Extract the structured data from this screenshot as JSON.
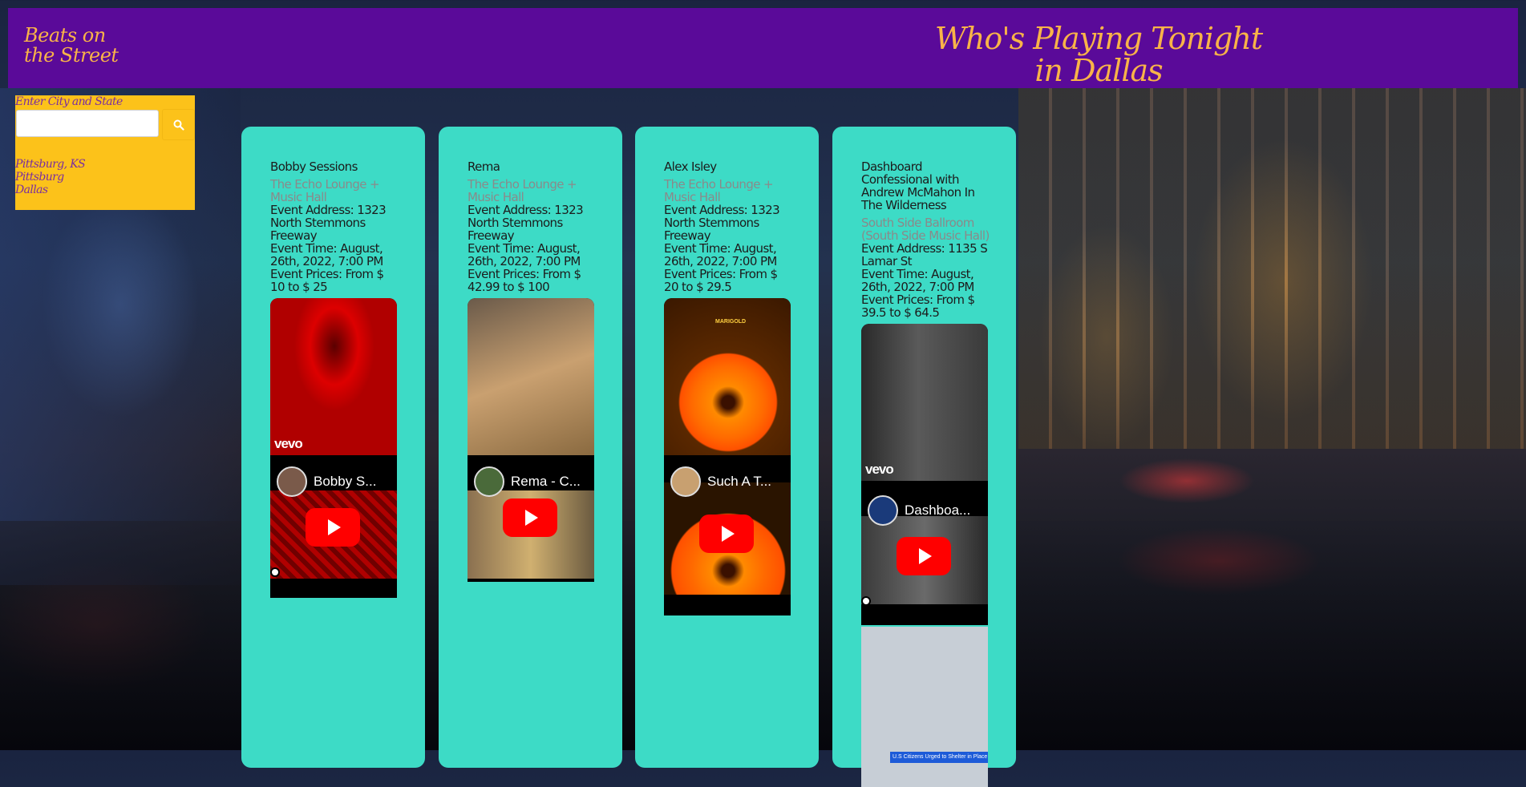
{
  "header": {
    "logo": "Beats on the Street",
    "headline": "Who's Playing Tonight in Dallas"
  },
  "search": {
    "label": "Enter City and State",
    "value": "",
    "history": [
      "Pittsburg, KS",
      "Pittsburg",
      "Dallas"
    ]
  },
  "events": [
    {
      "artist": "Bobby Sessions",
      "venue": "The Echo Lounge + Music Hall",
      "address": "Event Address: 1323 North Stemmons Freeway",
      "time": "Event Time: August, 26th, 2022, 7:00 PM",
      "prices": "Event Prices: From $ 10 to $ 25",
      "video_title": "Bobby S...",
      "video_badge": "vevo"
    },
    {
      "artist": "Rema",
      "venue": "The Echo Lounge + Music Hall",
      "address": "Event Address: 1323 North Stemmons Freeway",
      "time": "Event Time: August, 26th, 2022, 7:00 PM",
      "prices": "Event Prices: From $ 42.99 to $ 100",
      "video_title": "Rema - C..."
    },
    {
      "artist": "Alex Isley",
      "venue": "The Echo Lounge + Music Hall",
      "address": "Event Address: 1323 North Stemmons Freeway",
      "time": "Event Time: August, 26th, 2022, 7:00 PM",
      "prices": "Event Prices: From $ 20 to $ 29.5",
      "video_title": "Such A T...",
      "video_label": "MARIGOLD"
    },
    {
      "artist": "Dashboard Confessional with Andrew McMahon In The Wilderness",
      "venue": "South Side Ballroom (South Side Music Hall)",
      "address": "Event Address: 1135 S Lamar St",
      "time": "Event Time: August, 26th, 2022, 7:00 PM",
      "prices": "Event Prices: From $ 39.5 to $ 64.5",
      "video_title": "Dashboa...",
      "video_badge": "vevo",
      "news_caption": "U.S Citizens Urged to Shelter in Place"
    }
  ],
  "colors": {
    "header_bg": "#5a0a99",
    "accent_text": "#f9b348",
    "search_panel": "#fcc21a",
    "card_bg": "#3ddbc6",
    "youtube_red": "#ff0000"
  }
}
